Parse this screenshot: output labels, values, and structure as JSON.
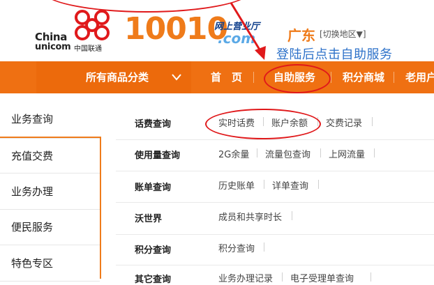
{
  "logo": {
    "china": "China",
    "unicom": "unicom",
    "unicom_cn": "中国联通",
    "hotline": "10010",
    "hall": "网上营业厅",
    "dotcom": ".com",
    "brand_color": "#ef7b1a"
  },
  "region": {
    "name": "广东",
    "switch_label": "[切换地区▼]"
  },
  "annotation_hint": "登陆后点击自助服务",
  "nav": {
    "category_label": "所有商品分类",
    "chevron": "chevron-down-icon",
    "items": [
      "首　页",
      "自助服务",
      "积分商城",
      "老用户"
    ],
    "bar_color": "#ef7012"
  },
  "sidebar": {
    "items": [
      "业务查询",
      "充值交费",
      "业务办理",
      "便民服务",
      "特色专区"
    ]
  },
  "content": {
    "rows": [
      {
        "title": "话费查询",
        "links": [
          "实时话费",
          "账户余额",
          "交费记录"
        ]
      },
      {
        "title": "使用量查询",
        "links": [
          "2G余量",
          "流量包查询",
          "上网流量"
        ]
      },
      {
        "title": "账单查询",
        "links": [
          "历史账单",
          "详单查询"
        ]
      },
      {
        "title": "沃世界",
        "links": [
          "成员和共享时长"
        ]
      },
      {
        "title": "积分查询",
        "links": [
          "积分查询"
        ]
      },
      {
        "title": "其它查询",
        "links": [
          "业务办理记录",
          "电子受理单查询"
        ]
      }
    ]
  },
  "colors": {
    "annotation_red": "#e0191b",
    "hint_blue": "#2e72c9"
  }
}
